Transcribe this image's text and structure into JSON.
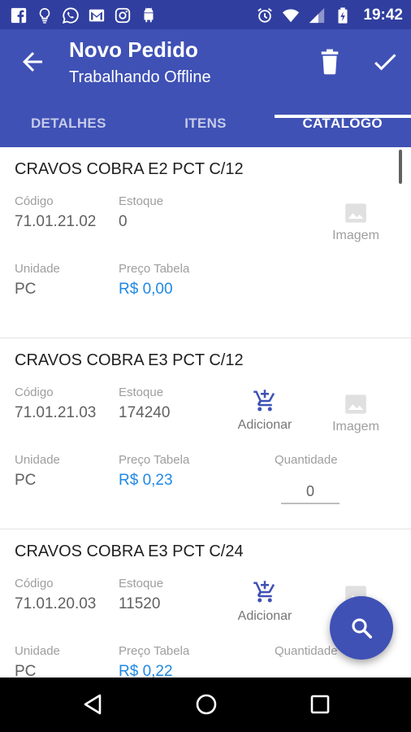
{
  "status_bar": {
    "time": "19:42",
    "left_icons": [
      "facebook-icon",
      "bulb-icon",
      "whatsapp-icon",
      "gmail-icon",
      "instagram-icon",
      "android-icon"
    ],
    "right_icons": [
      "alarm-icon",
      "wifi-icon",
      "signal-icon",
      "battery-icon"
    ]
  },
  "header": {
    "title": "Novo Pedido",
    "subtitle": "Trabalhando Offline",
    "color": "#3f51b5",
    "status_color": "#303e9f"
  },
  "tabs": [
    {
      "label": "DETALHES",
      "active": false
    },
    {
      "label": "ITENS",
      "active": false
    },
    {
      "label": "CATÁLOGO",
      "active": true
    }
  ],
  "items": [
    {
      "name": "CRAVOS COBRA E2  PCT C/12",
      "codigo_label": "Código",
      "codigo": "71.01.21.02",
      "estoque_label": "Estoque",
      "estoque": "0",
      "unidade_label": "Unidade",
      "unidade": "PC",
      "preco_label": "Preço Tabela",
      "preco": "R$ 0,00",
      "image_label": "Imagem"
    },
    {
      "name": "CRAVOS COBRA E3  PCT C/12",
      "codigo_label": "Código",
      "codigo": "71.01.21.03",
      "estoque_label": "Estoque",
      "estoque": "174240",
      "unidade_label": "Unidade",
      "unidade": "PC",
      "preco_label": "Preço Tabela",
      "preco": "R$ 0,23",
      "add_label": "Adicionar",
      "image_label": "Imagem",
      "quantidade_label": "Quantidade",
      "quantidade": "0"
    },
    {
      "name": "CRAVOS COBRA E3  PCT C/24",
      "codigo_label": "Código",
      "codigo": "71.01.20.03",
      "estoque_label": "Estoque",
      "estoque": "11520",
      "unidade_label": "Unidade",
      "unidade": "PC",
      "preco_label": "Preço Tabela",
      "preco": "R$ 0,22",
      "add_label": "Adicionar",
      "quantidade_label": "Quantidade"
    }
  ],
  "fab": {
    "icon": "search-icon",
    "color": "#3f51b5"
  },
  "nav_bar": {
    "icons": [
      "back-triangle-icon",
      "home-circle-icon",
      "recents-square-icon"
    ]
  }
}
